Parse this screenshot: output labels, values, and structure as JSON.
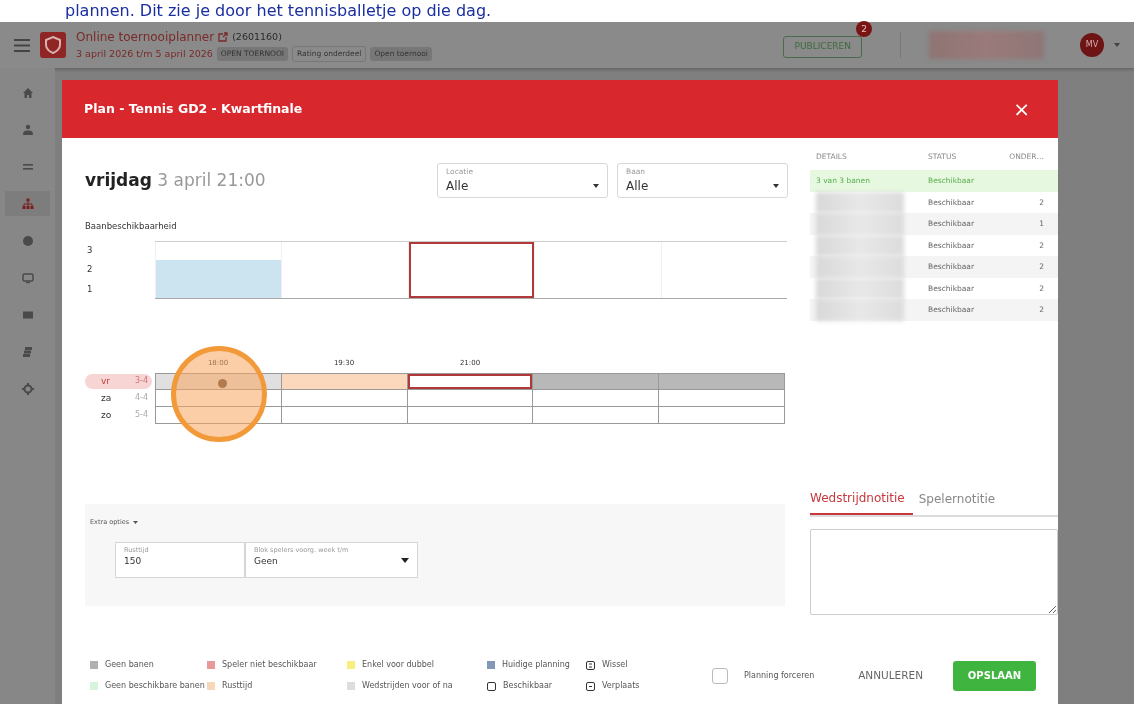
{
  "caption": "plannen. Dit zie je door het tennisballetje op die dag.",
  "navbar": {
    "title": "Online toernooiplanner",
    "number": "(2601160)",
    "dates": "3 april 2026 t/m 5 april 2026",
    "tags": [
      {
        "label": "OPEN TOERNOOI",
        "kind": "filled"
      },
      {
        "label": "Rating onderdeel",
        "kind": "outline"
      },
      {
        "label": "Open toernooi",
        "kind": "filled"
      }
    ],
    "publish": {
      "label": "PUBLICEREN",
      "badge": "2"
    },
    "avatar": "MV"
  },
  "sidebar": {
    "items": [
      {
        "kind": "home",
        "selected": false
      },
      {
        "kind": "person",
        "selected": false
      },
      {
        "kind": "list",
        "selected": false
      },
      {
        "kind": "tree",
        "selected": true
      },
      {
        "kind": "ball",
        "selected": false
      },
      {
        "kind": "screen",
        "selected": false
      },
      {
        "kind": "mail",
        "selected": false
      },
      {
        "kind": "stack",
        "selected": false
      },
      {
        "kind": "gear",
        "selected": false
      }
    ]
  },
  "modal": {
    "title": "Plan - Tennis GD2 - Kwartfinale",
    "close": "×",
    "day": "vrijdag",
    "datetime": "3 april 21:00",
    "filters": [
      {
        "label": "Locatie",
        "value": "Alle"
      },
      {
        "label": "Baan",
        "value": "Alle"
      }
    ],
    "availability": {
      "title": "Baanbeschikbaarheid",
      "y_labels": [
        "3",
        "2",
        "1"
      ],
      "slots": [
        {
          "kind": "partly_free",
          "selected": false
        },
        {
          "kind": "none_free",
          "selected": false
        },
        {
          "kind": "none_free",
          "selected": true
        },
        {
          "kind": "none_free",
          "selected": false
        },
        {
          "kind": "none_free",
          "selected": false
        }
      ]
    },
    "timeline": {
      "times": [
        "18:00",
        "19:30",
        "21:00"
      ],
      "rows": [
        {
          "day": "vr",
          "score": "3-4",
          "selected": true,
          "cells": [
            {
              "kind": "planned"
            },
            {
              "kind": "rest"
            },
            {
              "kind": "current"
            },
            {
              "kind": "no_courts"
            },
            {
              "kind": "no_courts"
            }
          ]
        },
        {
          "day": "za",
          "score": "4-4",
          "selected": false,
          "cells": [
            {
              "kind": "free"
            },
            {
              "kind": "free"
            },
            {
              "kind": "free"
            },
            {
              "kind": "free"
            },
            {
              "kind": "free"
            }
          ]
        },
        {
          "day": "zo",
          "score": "5-4",
          "selected": false,
          "cells": [
            {
              "kind": "free"
            },
            {
              "kind": "free"
            },
            {
              "kind": "free"
            },
            {
              "kind": "free"
            },
            {
              "kind": "free"
            }
          ]
        }
      ]
    },
    "extra_options": {
      "label": "Extra opties",
      "fields": [
        {
          "label": "Rusttijd",
          "value": "150",
          "kind": "input"
        },
        {
          "label": "Blok spelers voorg. week t/m",
          "value": "Geen",
          "kind": "select"
        }
      ]
    },
    "courts_table": {
      "columns": [
        "DETAILS",
        "STATUS",
        "ONDER…"
      ],
      "rows": [
        {
          "details": "3 van 3 banen",
          "status": "Beschikbaar",
          "count": "",
          "highlight": true,
          "redacted": false
        },
        {
          "status": "Beschikbaar",
          "count": "2",
          "highlight": false,
          "redacted": true
        },
        {
          "status": "Beschikbaar",
          "count": "1",
          "highlight": false,
          "redacted": true
        },
        {
          "status": "Beschikbaar",
          "count": "2",
          "highlight": false,
          "redacted": true
        },
        {
          "status": "Beschikbaar",
          "count": "2",
          "highlight": false,
          "redacted": true
        },
        {
          "status": "Beschikbaar",
          "count": "2",
          "highlight": false,
          "redacted": true
        },
        {
          "status": "Beschikbaar",
          "count": "2",
          "highlight": false,
          "redacted": true
        }
      ]
    },
    "note_tabs": [
      {
        "label": "Wedstrijdnotitie",
        "selected": true
      },
      {
        "label": "Spelernotitie",
        "selected": false
      }
    ],
    "legend": [
      {
        "label": "Geen banen",
        "kind": "swatch",
        "color": "#b0b0b0"
      },
      {
        "label": "Geen beschikbare banen",
        "kind": "swatch",
        "color": "#d6f3de"
      },
      {
        "label": "Speler niet beschikbaar",
        "kind": "swatch",
        "color": "#e89a9a"
      },
      {
        "label": "Rusttijd",
        "kind": "swatch",
        "color": "#f8d6b8"
      },
      {
        "label": "Enkel voor dubbel",
        "kind": "swatch",
        "color": "#f6ef7c"
      },
      {
        "label": "Wedstrijden voor of na",
        "kind": "swatch",
        "color": "#dddddd"
      },
      {
        "label": "Huidige planning",
        "kind": "swatch",
        "color": "#8497b8"
      },
      {
        "label": "Beschikbaar",
        "kind": "outline"
      },
      {
        "label": "Wissel",
        "kind": "swap"
      },
      {
        "label": "Verplaats",
        "kind": "move"
      }
    ],
    "force": {
      "label": "Planning forceren",
      "checked": false
    },
    "buttons": [
      {
        "label": "ANNULEREN",
        "kind": "text"
      },
      {
        "label": "OPSLAAN",
        "kind": "primary"
      }
    ]
  }
}
